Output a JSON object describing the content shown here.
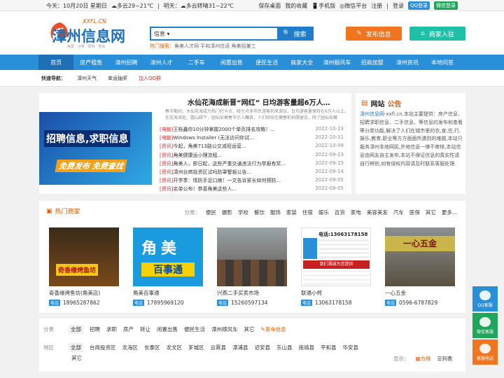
{
  "topbar": {
    "today_label": "今天：",
    "today_value": "10月20日 星期日",
    "weather_today": "多云29~21℃",
    "tomorrow_label": "明天：",
    "weather_tomorrow": "多云转晴31~22℃",
    "links": [
      "保存桌面",
      "我的收藏",
      "手机版",
      "微信平台"
    ],
    "register": "注册",
    "sep": "|",
    "login": "登录",
    "qq_login": "QQ登录",
    "wechat_login": "微信登录"
  },
  "logo": {
    "domain": "XXFL.CN",
    "name": "漳州信息网",
    "slogan": "免费 · 分类 · 发布 · 查看"
  },
  "search": {
    "select": "信息",
    "button": "搜索",
    "hot_label": "热门搜索：",
    "hot_terms": "角美人才网 平和漳州往返 角美招兼工"
  },
  "header_buttons": {
    "post": "发布信息",
    "merchant": "商家入驻"
  },
  "nav": [
    "首页",
    "房产租售",
    "漳州招聘",
    "漳州人才",
    "二手车",
    "闲置出售",
    "便民生活",
    "商家大全",
    "漳州顺风车",
    "招商加盟",
    "漳州资讯",
    "本地问答"
  ],
  "quick": {
    "label": "快速导航：",
    "items": [
      "漳州天气",
      "幸运抽奖",
      "加入QQ群"
    ]
  },
  "news": {
    "headline": "水仙花海成新晋“网红” 日均游客量超6万人…",
    "summary": "春节期间，水仙花海成为热门打卡点，吸引众多市民游客前来游玩，日均游客量保持在6万人以上。在花海深处，圆山脚下，园仙安嫩春节引人瞩目，人们纷纷在嫩春前拍照留念，除了园仙安嫩",
    "banner_line1": "招聘信息,求职信息",
    "banner_line2": "免费发布 免费查找",
    "items": [
      {
        "tag": "[电脑]",
        "title": "王栎鑫你10分钟掌握2000个单页排名攻略！...",
        "date": "2022-10-23"
      },
      {
        "tag": "[电脑]",
        "title": "Windows Installer (无法访问你试...",
        "date": "2022-10-11"
      },
      {
        "tag": "[资讯]",
        "title": "今起，角美713路公交减班运营...",
        "date": "2022-10-09"
      },
      {
        "tag": "[资讯]",
        "title": "角美健康运小理流程...",
        "date": "2022-09-23"
      },
      {
        "tag": "[资讯]",
        "title": "角美人，即日起，这些严重交通违法行为举报有奖...",
        "date": "2022-09-23"
      },
      {
        "tag": "[资讯]",
        "title": "漳州台商投资区试吗防罩警报公告...",
        "date": "2022-09-14"
      },
      {
        "tag": "[资讯]",
        "title": "开学季：情防手足口病！一文告诉家长如何预防...",
        "date": "2022-09-05"
      },
      {
        "tag": "[资讯]",
        "title": "名单公布！恭喜角美这些人...",
        "date": "2022-09-05"
      }
    ]
  },
  "notice": {
    "title_a": "网站",
    "title_b": "公告",
    "site": "漳州信息网",
    "body": "-xxfl.cn,本站主要提供：房产信息、招聘求职信息、二手信息、等信息的发布和查看等分类功能,解决了人们在城市里的衣,食,住,行,娱乐,教育,职业等方方面面所遇到的难题,本站只服务漳州本地网民,外地信息一律不审核,本站信息由网友自主发布,本站不保证信息的真实性请自行辨别,如有侵权内容请及时联系客服处理."
  },
  "shops": {
    "title": "热门商家",
    "cat_label": "分类：",
    "cats": [
      "便民",
      "摄影",
      "学校",
      "餐饮",
      "服饰",
      "家装",
      "住宿",
      "娱乐",
      "百货",
      "家电",
      "美容美发",
      "汽车",
      "医保",
      "其它",
      "更多..."
    ],
    "phone_tag": "电话",
    "items": [
      {
        "name": "奇香缘烤鱼坊(角美店)",
        "phone": "18965287862",
        "img_text": "奇香缘烤鱼坊"
      },
      {
        "name": "角美百事通",
        "phone": "17895969120",
        "img_text": "角美",
        "img_sub": "百事通"
      },
      {
        "name": "兴燕二手买卖市场",
        "phone": "15260597134",
        "img_text": ""
      },
      {
        "name": "联通小柯",
        "phone": "13063178158",
        "img_text": "电话:13063178158",
        "img_sub": "我们竭诚为您提供"
      },
      {
        "name": "一心五金",
        "phone": "0596-6787829",
        "img_text": "一心五金"
      }
    ]
  },
  "filter": {
    "cat_label": "分类",
    "cats": [
      "全部",
      "招聘",
      "求职",
      "房产",
      "转让",
      "闲置出售",
      "便民生活",
      "漳州顺风车",
      "其它"
    ],
    "post": "发布信息",
    "area_label": "地区",
    "areas": [
      "全部",
      "台商投资区",
      "龙海区",
      "长泰区",
      "龙文区",
      "芗城区",
      "云霄县",
      "漳浦县",
      "诏安县",
      "东山县",
      "南靖县",
      "平和县",
      "华安县",
      "其它"
    ],
    "display_label": "显示：",
    "view_grid": "方框",
    "view_list": "列表"
  },
  "sidebar": [
    "QQ客服",
    "微信客服",
    "客服电话"
  ],
  "colors": {
    "brand_blue": "#2a8fd9",
    "orange": "#f0751e",
    "teal": "#1ec0a8"
  }
}
